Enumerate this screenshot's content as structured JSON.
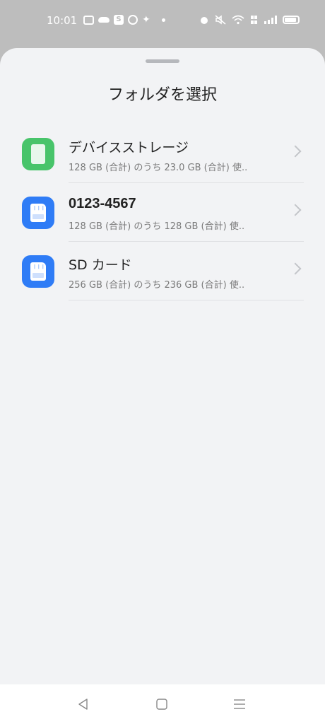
{
  "status_bar": {
    "time": "10:01",
    "left_icons": [
      "message-icon",
      "cloud-icon",
      "s-app-icon",
      "circle-app-icon",
      "game-app-icon",
      "dot-icon"
    ],
    "right_icons": [
      "alarm-icon",
      "mute-icon",
      "wifi-icon",
      "volte-icon",
      "signal-icon",
      "battery-icon"
    ]
  },
  "sheet": {
    "title": "フォルダを選択"
  },
  "folders": [
    {
      "name": "デバイスストレージ",
      "detail": "128 GB (合計) のうち 23.0 GB (合計) 使..",
      "icon": "phone-storage-icon",
      "icon_color": "#48c46a"
    },
    {
      "name": "0123-4567",
      "detail": "128 GB (合計) のうち 128 GB (合計) 使..",
      "icon": "sd-card-icon",
      "icon_color": "#2f7cf6"
    },
    {
      "name": "SD カード",
      "detail": "256 GB (合計) のうち 236 GB (合計) 使..",
      "icon": "sd-card-icon",
      "icon_color": "#2f7cf6"
    }
  ],
  "nav_bar": {
    "buttons": [
      "back-icon",
      "home-icon",
      "recents-icon"
    ]
  }
}
